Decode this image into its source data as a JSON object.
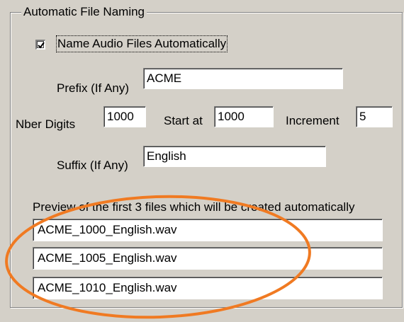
{
  "group": {
    "title": "Automatic File Naming"
  },
  "auto_name": {
    "label": "Name Audio Files Automatically",
    "checked": true
  },
  "prefix": {
    "label": "Prefix (If Any)",
    "value": "ACME"
  },
  "digits": {
    "label": "Nber Digits",
    "value": "1000"
  },
  "start": {
    "label": "Start at",
    "value": "1000"
  },
  "increment": {
    "label": "Increment",
    "value": "5"
  },
  "suffix": {
    "label": "Suffix (If Any)",
    "value": "English"
  },
  "preview": {
    "label": "Preview of the first 3 files which will be created automatically",
    "files": [
      "ACME_1000_English.wav",
      "ACME_1005_English.wav",
      "ACME_1010_English.wav"
    ]
  },
  "annotation": {
    "color": "#f07a22"
  }
}
